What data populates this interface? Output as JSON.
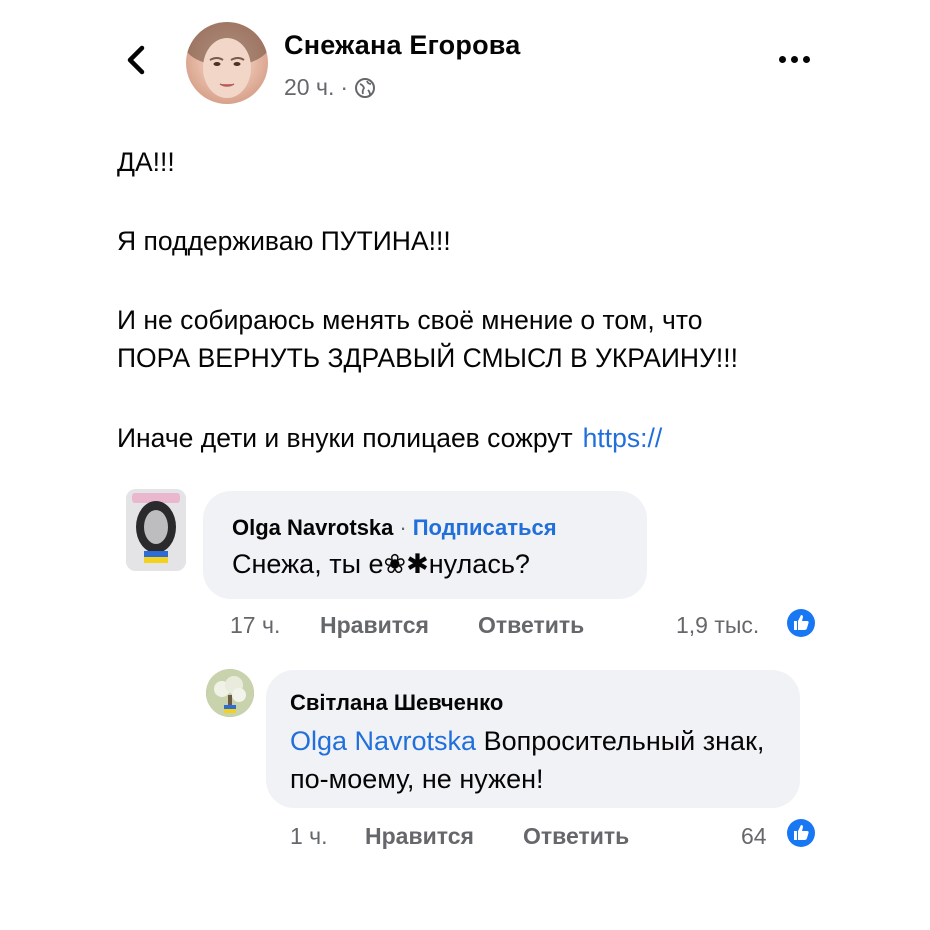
{
  "post": {
    "author": "Снежана Егорова",
    "time": "20 ч.",
    "separator": "·",
    "lines": [
      "ДА!!!",
      "Я поддерживаю ПУТИНА!!!",
      "И не собираюсь менять своё мнение о том, что",
      "ПОРА ВЕРНУТЬ ЗДРАВЫЙ СМЫСЛ В УКРАИНУ!!!",
      "Иначе дети и внуки полицаев сожрут"
    ],
    "link": "https://"
  },
  "comments": [
    {
      "author": "Olga Navrotska",
      "separator": "·",
      "follow": "Подписаться",
      "text": "Снежа, ты е❀✱нулась?",
      "time": "17 ч.",
      "like": "Нравится",
      "reply": "Ответить",
      "reactions": "1,9 тыс."
    },
    {
      "author": "Світлана Шевченко",
      "mention": "Olga Navrotska",
      "text": "Вопросительный знак, по-моему, не нужен!",
      "time": "1 ч.",
      "like": "Нравится",
      "reply": "Ответить",
      "reactions": "64"
    }
  ],
  "icons": {
    "back": "chevron-left-icon",
    "privacy": "globe-icon",
    "more": "more-horizontal-icon",
    "reaction": "like-reaction-icon"
  },
  "colors": {
    "link": "#216fdb",
    "muted": "#65676b",
    "bubble": "#f0f2f5",
    "like": "#1877f2"
  }
}
